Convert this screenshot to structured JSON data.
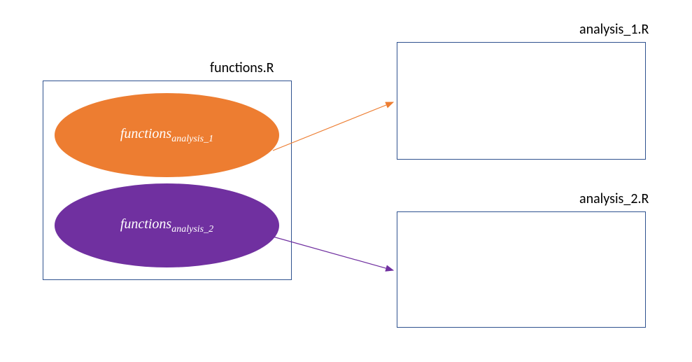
{
  "labels": {
    "functions_box": "functions.R",
    "analysis_1_box": "analysis_1.R",
    "analysis_2_box": "analysis_2.R"
  },
  "ellipses": {
    "e1": {
      "base": "functions",
      "sub": "analysis_1"
    },
    "e2": {
      "base": "functions",
      "sub": "analysis_2"
    }
  },
  "colors": {
    "box_border": "#2F528F",
    "ellipse1_fill": "#ED7D31",
    "ellipse2_fill": "#7030A0",
    "arrow1": "#ED7D31",
    "arrow2": "#7030A0"
  },
  "chart_data": {
    "type": "table",
    "title": "Functions file mapping to analysis scripts",
    "nodes": [
      {
        "id": "functions_R",
        "label": "functions.R",
        "kind": "container"
      },
      {
        "id": "functions_analysis_1",
        "label": "functions_analysis_1",
        "kind": "group",
        "parent": "functions_R"
      },
      {
        "id": "functions_analysis_2",
        "label": "functions_analysis_2",
        "kind": "group",
        "parent": "functions_R"
      },
      {
        "id": "analysis_1_R",
        "label": "analysis_1.R",
        "kind": "file"
      },
      {
        "id": "analysis_2_R",
        "label": "analysis_2.R",
        "kind": "file"
      }
    ],
    "edges": [
      {
        "from": "functions_analysis_1",
        "to": "analysis_1_R"
      },
      {
        "from": "functions_analysis_2",
        "to": "analysis_2_R"
      }
    ]
  }
}
